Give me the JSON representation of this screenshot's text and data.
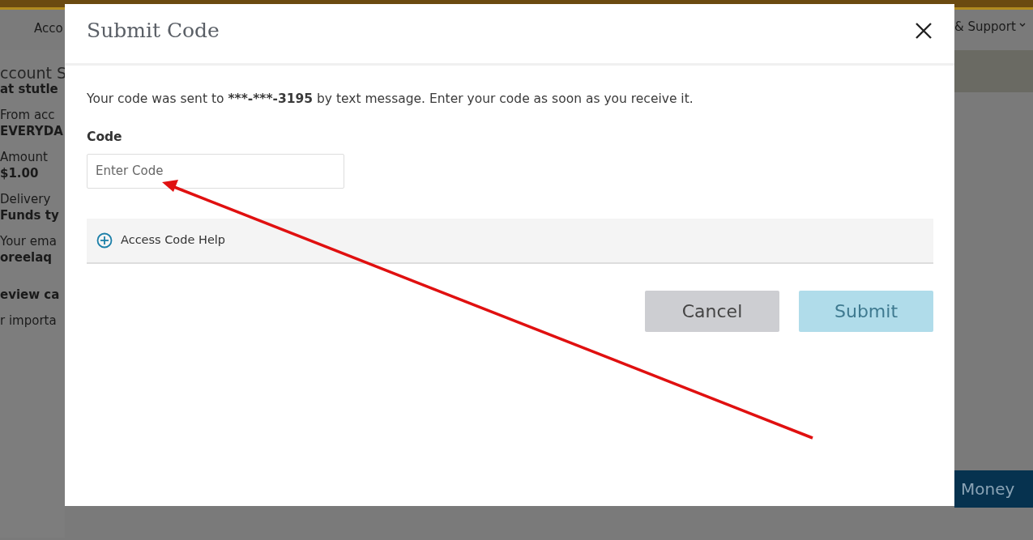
{
  "background": {
    "nav_left": "Acco",
    "nav_right": "& Support",
    "left_texts": [
      {
        "text": "ccount S",
        "kind": "heading"
      },
      {
        "text": "at stutle",
        "kind": "bold"
      },
      {
        "text": "From acc",
        "kind": "label"
      },
      {
        "text": "EVERYDA",
        "kind": "bold"
      },
      {
        "text": "Amount",
        "kind": "label"
      },
      {
        "text": "$1.00",
        "kind": "bold"
      },
      {
        "text": "Delivery",
        "kind": "label"
      },
      {
        "text": "Funds ty",
        "kind": "bold"
      },
      {
        "text": "Your ema",
        "kind": "label"
      },
      {
        "text": "oreelaq",
        "kind": "bold"
      },
      {
        "text": "eview ca",
        "kind": "bold"
      },
      {
        "text": "r importa",
        "kind": "label"
      }
    ],
    "action_button": "Money"
  },
  "modal": {
    "title": "Submit Code",
    "message": [
      {
        "text": "Your code was sent to ",
        "bold": false
      },
      {
        "text": "***-***-3195",
        "bold": true
      },
      {
        "text": " by text message. Enter your code as soon as you receive it.",
        "bold": false
      }
    ],
    "field_label": "Code",
    "placeholder": "Enter Code",
    "help": {
      "label": "Access Code Help",
      "expanded": false
    },
    "buttons": [
      {
        "label": "Cancel",
        "kind": "secondary",
        "disabled": false
      },
      {
        "label": "Submit",
        "kind": "primary",
        "disabled": true
      }
    ]
  }
}
